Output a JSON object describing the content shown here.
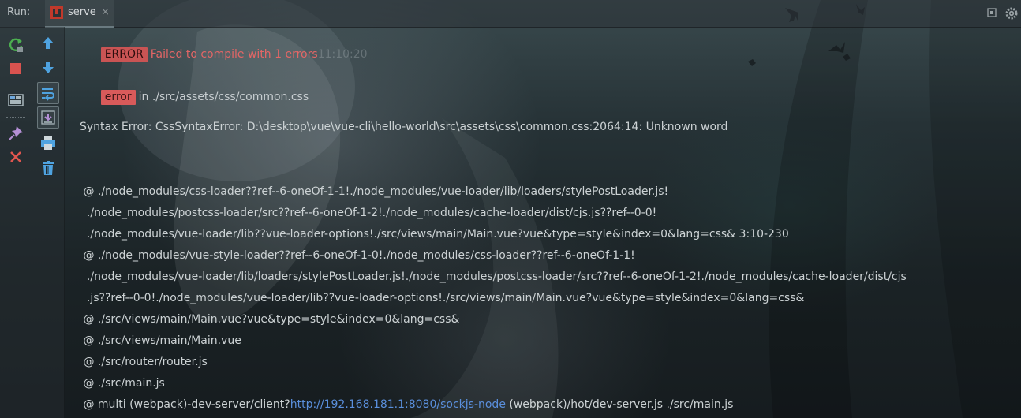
{
  "window": {
    "run_label": "Run:",
    "tab_label": "serve",
    "tab_close": "×"
  },
  "icons": {
    "rerun": "rerun-icon",
    "stop": "stop-icon",
    "layout": "layout-icon",
    "pin": "pin-icon",
    "close": "close-icon",
    "up": "arrow-up-icon",
    "down": "arrow-down-icon",
    "soft_wrap": "soft-wrap-icon",
    "scroll_end": "scroll-to-end-icon",
    "print": "print-icon",
    "trash": "trash-icon",
    "settings": "gear-icon",
    "window_restore": "restore-icon"
  },
  "colors": {
    "error_red": "#e36666",
    "badge_red": "#d85a5a",
    "link_blue": "#5a8fdc"
  },
  "console": {
    "header_badge": "ERROR",
    "header_message": "Failed to compile with 1 errors",
    "header_time": "11:10:20",
    "error_badge": "error",
    "error_location": "in ./src/assets/css/common.css",
    "syntax_error": "Syntax Error: CssSyntaxError: D:\\desktop\\vue\\vue-cli\\hello-world\\src\\assets\\css\\common.css:2064:14: Unknown word",
    "stack": [
      " @ ./node_modules/css-loader??ref--6-oneOf-1-1!./node_modules/vue-loader/lib/loaders/stylePostLoader.js!",
      "  ./node_modules/postcss-loader/src??ref--6-oneOf-1-2!./node_modules/cache-loader/dist/cjs.js??ref--0-0!",
      "  ./node_modules/vue-loader/lib??vue-loader-options!./src/views/main/Main.vue?vue&type=style&index=0&lang=css& 3:10-230",
      " @ ./node_modules/vue-style-loader??ref--6-oneOf-1-0!./node_modules/css-loader??ref--6-oneOf-1-1!",
      "  ./node_modules/vue-loader/lib/loaders/stylePostLoader.js!./node_modules/postcss-loader/src??ref--6-oneOf-1-2!./node_modules/cache-loader/dist/cjs",
      "  .js??ref--0-0!./node_modules/vue-loader/lib??vue-loader-options!./src/views/main/Main.vue?vue&type=style&index=0&lang=css&",
      " @ ./src/views/main/Main.vue?vue&type=style&index=0&lang=css&",
      " @ ./src/views/main/Main.vue",
      " @ ./src/router/router.js",
      " @ ./src/main.js"
    ],
    "last_prefix": " @ multi (webpack)-dev-server/client?",
    "last_link": "http://192.168.181.1:8080/sockjs-node",
    "last_suffix": " (webpack)/hot/dev-server.js ./src/main.js"
  }
}
